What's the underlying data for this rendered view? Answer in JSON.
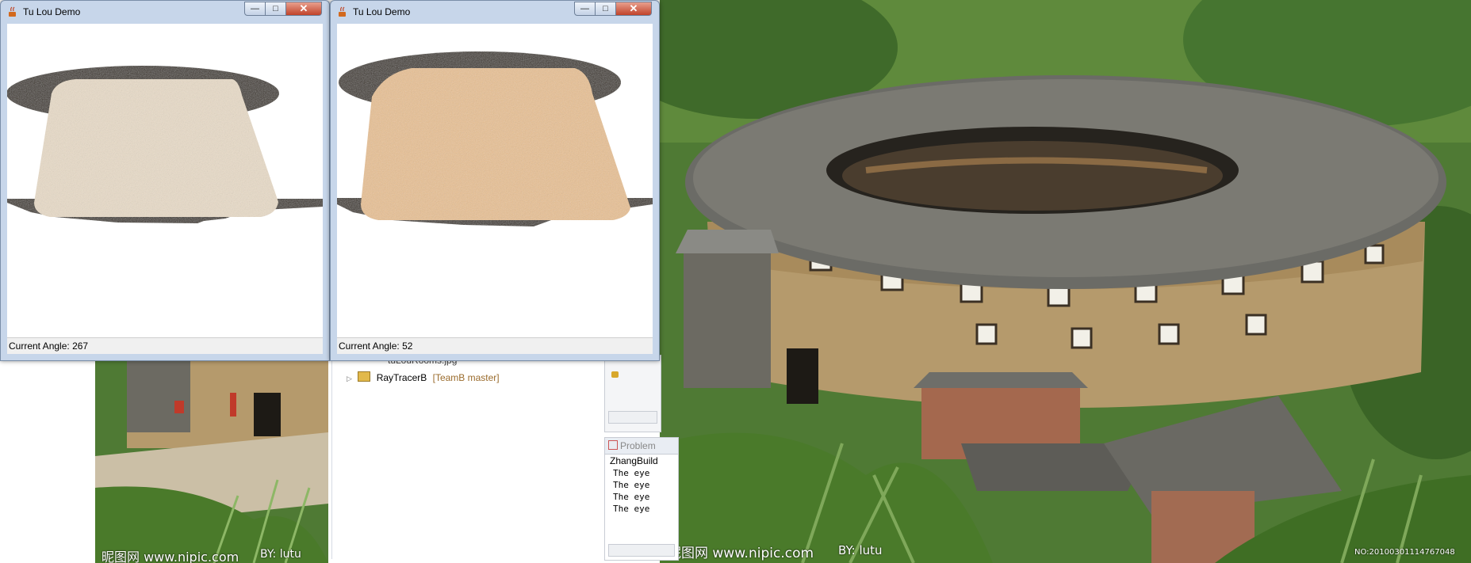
{
  "windows": [
    {
      "title": "Tu Lou Demo",
      "status_label": "Current Angle:",
      "angle": "267",
      "wall_color": "#e9dcc8",
      "roof_color": "#3a3326"
    },
    {
      "title": "Tu Lou Demo",
      "status_label": "Current Angle:",
      "angle": "52",
      "wall_color": "#e9c193",
      "roof_color": "#3a3326"
    }
  ],
  "window_controls": {
    "minimize": "—",
    "maximize": "□",
    "close": "✕"
  },
  "ide": {
    "tree_partial": "tuLouRooms.jpg",
    "project_name": "RayTracerB",
    "project_branch": "[TeamB master]",
    "problems_tab": "Problem",
    "console_title": "ZhangBuild",
    "console_lines": [
      "The eye",
      "The eye",
      "The eye",
      "The eye"
    ]
  },
  "watermarks": {
    "site_left": "昵图网 www.nipic.com",
    "author_left": "BY: lutu",
    "site_right": "昵图网 www.nipic.com",
    "author_right": "BY: lutu",
    "image_no": "NO:20100301114767048"
  },
  "colors": {
    "window_frame": "#c7d6ea",
    "close_button": "#c1432a",
    "roof_tiles": "#6b6b66",
    "earth_wall": "#b59a6c",
    "foliage": "#3e6b2c"
  }
}
